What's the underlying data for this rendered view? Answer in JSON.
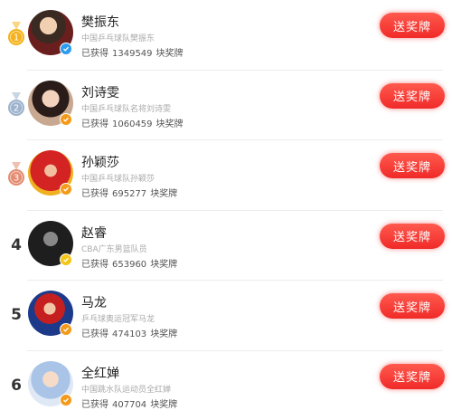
{
  "colors": {
    "button": "#f23a35",
    "gold": "#f5b21c",
    "silver": "#9db3cc",
    "bronze": "#e48d72",
    "verify_blue": "#2d9cf0",
    "verify_orange": "#f39a1b",
    "verify_gold": "#f5c518"
  },
  "rankings": [
    {
      "rank": "1",
      "medal": "gold",
      "name": "樊振东",
      "subtitle": "中国乒乓球队樊振东",
      "count_prefix": "已获得",
      "count": "1349549",
      "count_suffix": "块奖牌",
      "button_label": "送奖牌",
      "verify": "blue",
      "avatar_icon": "avatar-photo"
    },
    {
      "rank": "2",
      "medal": "silver",
      "name": "刘诗雯",
      "subtitle": "中国乒乓球队名将刘诗雯",
      "count_prefix": "已获得",
      "count": "1060459",
      "count_suffix": "块奖牌",
      "button_label": "送奖牌",
      "verify": "orange",
      "avatar_icon": "avatar-photo"
    },
    {
      "rank": "3",
      "medal": "bronze",
      "name": "孙颖莎",
      "subtitle": "中国乒乓球队孙颖莎",
      "count_prefix": "已获得",
      "count": "695277",
      "count_suffix": "块奖牌",
      "button_label": "送奖牌",
      "verify": "orange",
      "avatar_icon": "avatar-photo"
    },
    {
      "rank": "4",
      "medal": "none",
      "name": "赵睿",
      "subtitle": "CBA广东男篮队员",
      "count_prefix": "已获得",
      "count": "653960",
      "count_suffix": "块奖牌",
      "button_label": "送奖牌",
      "verify": "gold",
      "avatar_icon": "avatar-photo"
    },
    {
      "rank": "5",
      "medal": "none",
      "name": "马龙",
      "subtitle": "乒乓球奥运冠军马龙",
      "count_prefix": "已获得",
      "count": "474103",
      "count_suffix": "块奖牌",
      "button_label": "送奖牌",
      "verify": "orange",
      "avatar_icon": "avatar-photo"
    },
    {
      "rank": "6",
      "medal": "none",
      "name": "全红婵",
      "subtitle": "中国跳水队运动员全红婵",
      "count_prefix": "已获得",
      "count": "407704",
      "count_suffix": "块奖牌",
      "button_label": "送奖牌",
      "verify": "orange",
      "avatar_icon": "avatar-photo"
    }
  ]
}
